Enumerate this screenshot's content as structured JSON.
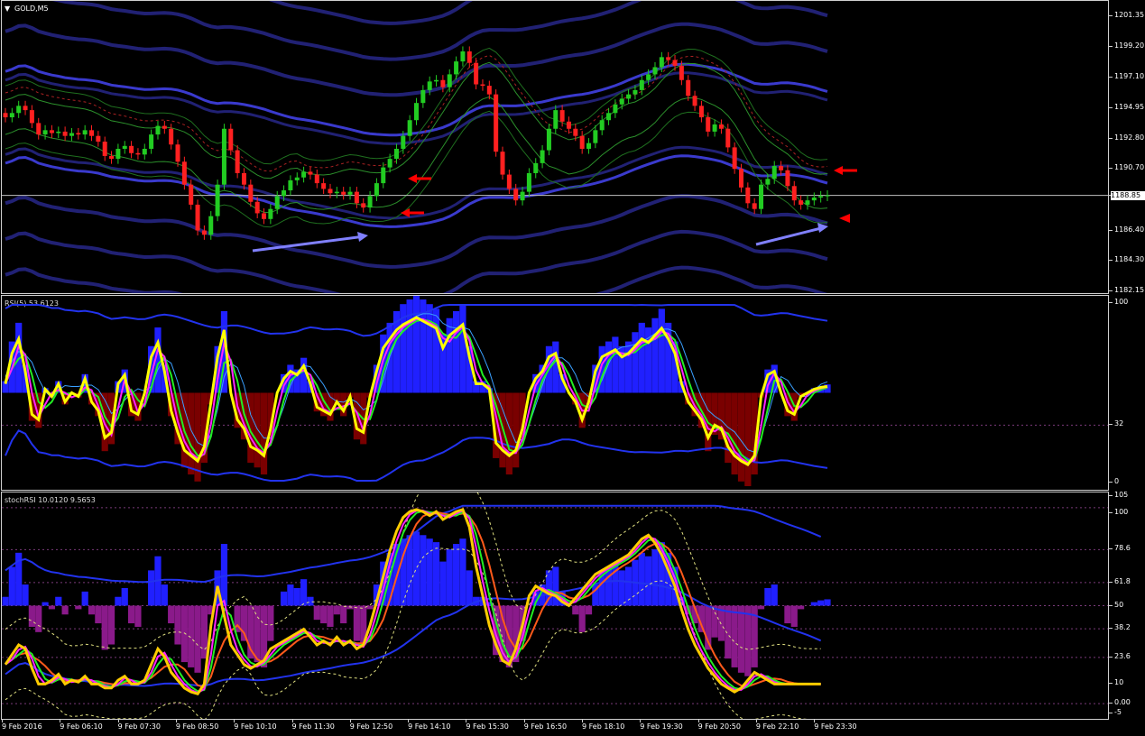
{
  "window_title": "GOLD,M5",
  "current_price": "1188.85",
  "panes": {
    "price": {
      "ticks": [
        "1201.35",
        "1199.20",
        "1197.10",
        "1194.95",
        "1192.80",
        "1190.70",
        "1188.85",
        "1186.40",
        "1184.30",
        "1182.15"
      ]
    },
    "rsi": {
      "label": "RSI(5) 53.6123",
      "ticks": [
        "100",
        "32",
        "0"
      ]
    },
    "stoch": {
      "label": "stochRSI 10.0120 9.5653",
      "ticks": [
        "105",
        "100",
        "78.6",
        "61.8",
        "50",
        "38.2",
        "23.6",
        "10",
        "0.00",
        "-5"
      ]
    }
  },
  "x_labels": [
    "9 Feb 2016",
    "9 Feb 06:10",
    "9 Feb 07:30",
    "9 Feb 08:50",
    "9 Feb 10:10",
    "9 Feb 11:30",
    "9 Feb 12:50",
    "9 Feb 14:10",
    "9 Feb 15:30",
    "9 Feb 16:50",
    "9 Feb 18:10",
    "9 Feb 19:30",
    "9 Feb 20:50",
    "9 Feb 22:10",
    "9 Feb 23:30"
  ],
  "colors": {
    "bull": "#22cc22",
    "bear": "#ff2020",
    "band": "#23237a",
    "band_bright": "#3d3dd8",
    "rsi_main": "#ffff00",
    "hist_pos": "#2020ff",
    "hist_neg_rsi": "#7a0000",
    "hist_neg_stoch": "#8a1a8a",
    "arrow_red": "#ff0000",
    "arrow_blue": "#8080ff"
  },
  "chart_data": [
    {
      "type": "candlestick",
      "title": "GOLD,M5",
      "ylim": [
        1182.15,
        1202.3
      ],
      "close_series": [
        1194.3,
        1194.6,
        1195.1,
        1194.8,
        1193.9,
        1193.1,
        1193.4,
        1193.2,
        1193.3,
        1193.0,
        1193.2,
        1193.1,
        1193.4,
        1193.0,
        1192.6,
        1191.6,
        1191.4,
        1192.1,
        1192.3,
        1191.8,
        1191.7,
        1192.1,
        1193.1,
        1193.7,
        1193.5,
        1192.4,
        1191.2,
        1189.6,
        1188.2,
        1186.4,
        1186.1,
        1187.4,
        1189.6,
        1193.5,
        1192.0,
        1190.4,
        1189.6,
        1188.4,
        1187.6,
        1187.2,
        1187.9,
        1188.8,
        1189.2,
        1189.9,
        1190.1,
        1190.5,
        1190.3,
        1189.7,
        1189.3,
        1189.0,
        1189.1,
        1188.9,
        1189.1,
        1188.3,
        1188.0,
        1188.8,
        1189.7,
        1190.8,
        1191.4,
        1192.1,
        1193.0,
        1194.1,
        1195.3,
        1196.2,
        1196.8,
        1196.9,
        1196.4,
        1197.3,
        1198.2,
        1198.9,
        1198.1,
        1196.6,
        1196.5,
        1195.9,
        1191.9,
        1190.3,
        1189.3,
        1188.5,
        1189.1,
        1190.4,
        1191.1,
        1192.0,
        1193.5,
        1194.8,
        1194.0,
        1193.5,
        1193.0,
        1192.1,
        1192.5,
        1193.4,
        1194.1,
        1194.6,
        1195.2,
        1195.6,
        1195.9,
        1196.2,
        1196.9,
        1197.3,
        1197.8,
        1198.5,
        1198.3,
        1197.9,
        1196.9,
        1195.8,
        1195.1,
        1194.3,
        1193.3,
        1193.8,
        1193.5,
        1192.2,
        1190.7,
        1189.4,
        1188.3,
        1187.9,
        1189.6,
        1190.0,
        1190.9,
        1190.6,
        1189.5,
        1188.5,
        1188.2,
        1188.5,
        1188.7,
        1188.8,
        1188.85
      ]
    },
    {
      "type": "line",
      "title": "RSI(5) 53.6123",
      "ylim": [
        0,
        100
      ],
      "series": [
        {
          "name": "RSI(5)",
          "values": [
            55,
            72,
            80,
            62,
            38,
            35,
            52,
            48,
            55,
            45,
            50,
            48,
            58,
            45,
            40,
            25,
            28,
            55,
            60,
            40,
            38,
            50,
            70,
            78,
            62,
            40,
            28,
            18,
            15,
            12,
            20,
            45,
            70,
            85,
            50,
            35,
            30,
            20,
            18,
            15,
            30,
            50,
            58,
            62,
            60,
            65,
            55,
            42,
            40,
            38,
            45,
            40,
            48,
            30,
            28,
            48,
            62,
            75,
            80,
            85,
            88,
            90,
            92,
            90,
            88,
            86,
            75,
            82,
            85,
            88,
            70,
            55,
            55,
            52,
            22,
            18,
            15,
            18,
            30,
            50,
            58,
            62,
            70,
            72,
            58,
            50,
            45,
            35,
            45,
            62,
            70,
            72,
            74,
            70,
            72,
            76,
            80,
            78,
            82,
            86,
            80,
            72,
            55,
            45,
            40,
            35,
            25,
            32,
            30,
            20,
            15,
            12,
            10,
            15,
            48,
            60,
            62,
            50,
            40,
            38,
            48,
            50,
            52,
            53,
            53.6
          ]
        }
      ]
    },
    {
      "type": "line",
      "title": "stochRSI 10.0120 9.5653",
      "ylim": [
        -5,
        105
      ],
      "series": [
        {
          "name": "stochRSI",
          "values": [
            20,
            25,
            30,
            28,
            18,
            10,
            10,
            12,
            15,
            10,
            12,
            11,
            14,
            10,
            10,
            8,
            8,
            12,
            14,
            10,
            10,
            12,
            20,
            28,
            24,
            16,
            12,
            8,
            6,
            5,
            10,
            40,
            60,
            45,
            30,
            25,
            20,
            18,
            20,
            22,
            28,
            30,
            32,
            34,
            36,
            38,
            34,
            30,
            32,
            30,
            34,
            30,
            32,
            28,
            30,
            40,
            52,
            65,
            78,
            88,
            95,
            98,
            99,
            98,
            96,
            98,
            94,
            96,
            98,
            99,
            90,
            70,
            55,
            40,
            30,
            22,
            20,
            28,
            40,
            55,
            60,
            58,
            56,
            55,
            52,
            50,
            54,
            58,
            62,
            66,
            68,
            70,
            72,
            74,
            76,
            80,
            84,
            86,
            82,
            76,
            68,
            60,
            48,
            38,
            30,
            24,
            18,
            14,
            10,
            8,
            6,
            8,
            12,
            16,
            14,
            12,
            10,
            10,
            10,
            10,
            10,
            10,
            10,
            10.0
          ]
        }
      ]
    }
  ]
}
